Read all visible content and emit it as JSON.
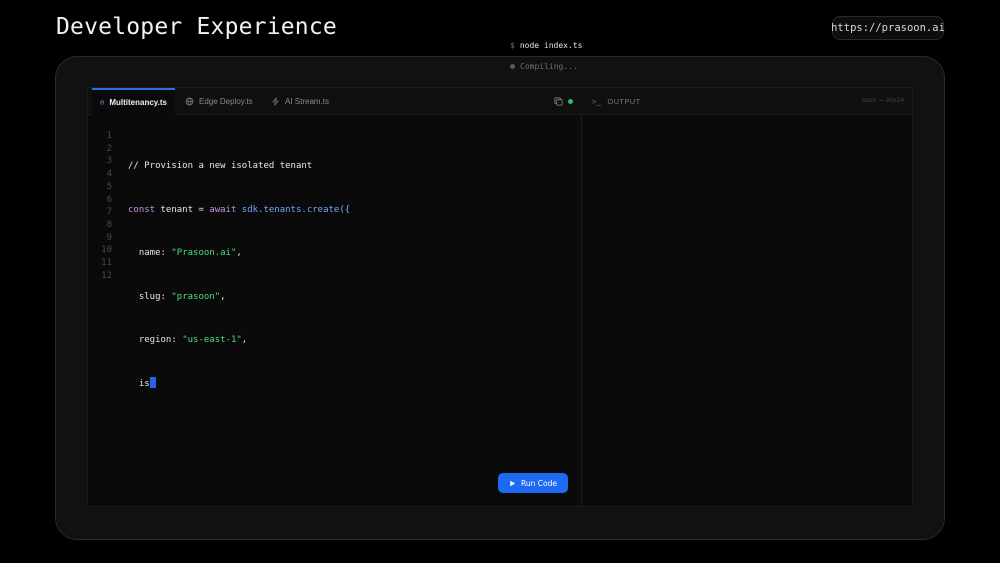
{
  "slide": {
    "title": "Developer Experience",
    "url": "https://prasoon.ai"
  },
  "tabs": [
    {
      "label": "Multitenancy.ts",
      "icon": "database-icon",
      "active": true
    },
    {
      "label": "Edge Deploy.ts",
      "icon": "globe-icon",
      "active": false
    },
    {
      "label": "AI Stream.ts",
      "icon": "lightning-icon",
      "active": false
    }
  ],
  "editor": {
    "line_numbers": [
      "1",
      "2",
      "3",
      "4",
      "5",
      "6",
      "7",
      "8",
      "9",
      "10",
      "11",
      "12"
    ],
    "code": {
      "comment": "// Provision a new isolated tenant",
      "l2_kw1": "const",
      "l2_var": " tenant = ",
      "l2_kw2": "await",
      "l2_call": " sdk.tenants.create({",
      "l3_key": "  name: ",
      "l3_val": "\"Prasoon.ai\"",
      "l3_end": ",",
      "l4_key": "  slug: ",
      "l4_val": "\"prasoon\"",
      "l4_end": ",",
      "l5_key": "  region: ",
      "l5_val": "\"us-east-1\"",
      "l5_end": ",",
      "l6_text": "  is"
    },
    "run_label": "Run Code"
  },
  "output": {
    "prefix": ">_",
    "title": "OUTPUT",
    "meta": "bash — 80x24",
    "prompt": "$",
    "command": "node index.ts",
    "status": "Compiling..."
  },
  "colors": {
    "accent": "#1d6af5",
    "status_green": "#22c55e",
    "string": "#4ade80",
    "keyword": "#c792ea"
  }
}
